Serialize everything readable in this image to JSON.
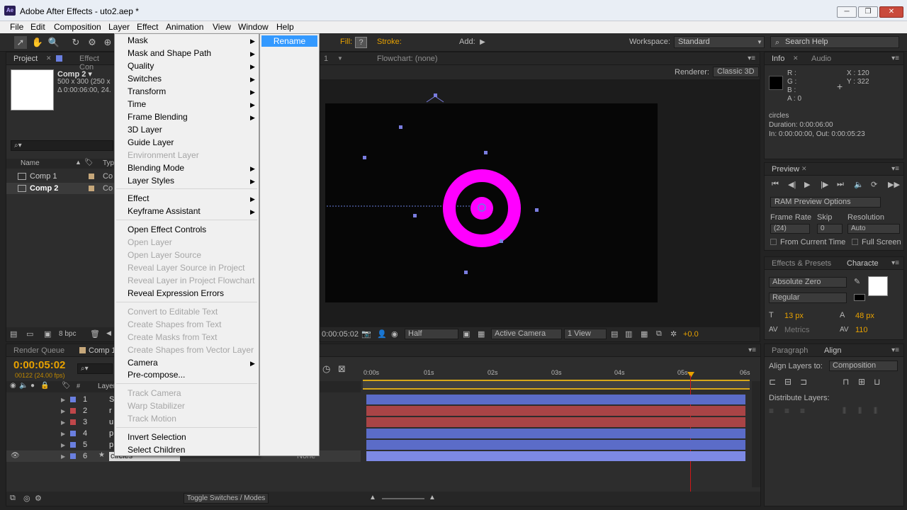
{
  "window": {
    "title": "Adobe After Effects - uto2.aep *",
    "app_icon": "Ae"
  },
  "menubar": {
    "items": [
      "File",
      "Edit",
      "Composition",
      "Layer",
      "Effect",
      "Animation",
      "View",
      "Window",
      "Help"
    ]
  },
  "toolbar": {
    "fill_label": "Fill:",
    "stroke_label": "Stroke:",
    "add_label": "Add:",
    "workspace_label": "Workspace:",
    "workspace_value": "Standard",
    "search_placeholder": "Search Help"
  },
  "project_panel": {
    "tabs": [
      "Project",
      "Effect Con"
    ],
    "comp_name": "Comp 2 ▾",
    "comp_size": "500 x 300  (250 x",
    "comp_duration": "Δ 0:00:06:00, 24.",
    "column_name": "Name",
    "column_type": "Typ",
    "items": [
      {
        "name": "Comp 1",
        "type": "Co"
      },
      {
        "name": "Comp 2",
        "type": "Co"
      }
    ],
    "bpc": "8 bpc"
  },
  "viewer": {
    "tab_flowchart": "Flowchart: (none)",
    "tab_comp_num": "1",
    "renderer_label": "Renderer:",
    "renderer_value": "Classic 3D",
    "timecode": "0:00:05:02",
    "resolution": "Half",
    "camera": "Active Camera",
    "views": "1 View",
    "exposure": "+0.0"
  },
  "info_panel": {
    "tabs": [
      "Info",
      "Audio"
    ],
    "r": "R :",
    "g": "G :",
    "b": "B :",
    "a": "A :  0",
    "x": "X : 120",
    "y": "Y : 322",
    "layer_name": "circles",
    "duration": "Duration: 0:00:06:00",
    "in_out": "In: 0:00:00:00, Out: 0:00:05:23"
  },
  "preview_panel": {
    "tab": "Preview",
    "ram_options": "RAM Preview Options",
    "frame_rate_label": "Frame Rate",
    "skip_label": "Skip",
    "resolution_label": "Resolution",
    "frame_rate_value": "(24)",
    "skip_value": "0",
    "resolution_value": "Auto",
    "from_current": "From Current Time",
    "full_screen": "Full Screen"
  },
  "character_panel": {
    "tabs": [
      "Effects & Presets",
      "Characte"
    ],
    "font": "Absolute Zero",
    "style": "Regular",
    "size": "13 px",
    "leading": "48 px",
    "kerning": "Metrics",
    "tracking": "110"
  },
  "align_panel": {
    "tabs": [
      "Paragraph",
      "Align"
    ],
    "align_to_label": "Align Layers to:",
    "align_to_value": "Composition",
    "distribute_label": "Distribute Layers:"
  },
  "timeline": {
    "tabs": [
      "Render Queue",
      "Comp 1"
    ],
    "timecode": "0:00:05:02",
    "frames": "00122 (24.00 fps)",
    "ruler": [
      "0:00s",
      "01s",
      "02s",
      "03s",
      "04s",
      "05s",
      "06s"
    ],
    "layer_col": "Layer",
    "layers": [
      {
        "num": "1",
        "letter": "S",
        "color": "#6a7fe0"
      },
      {
        "num": "2",
        "letter": "r",
        "color": "#c0474a"
      },
      {
        "num": "3",
        "letter": "u",
        "color": "#c0474a"
      },
      {
        "num": "4",
        "letter": "p",
        "color": "#6a7fe0"
      },
      {
        "num": "5",
        "letter": "p",
        "color": "#6a7fe0"
      },
      {
        "num": "6",
        "letter": "circles",
        "color": "#6a7fe0"
      }
    ],
    "parent_none": "None",
    "toggle_label": "Toggle Switches / Modes"
  },
  "layer_menu": {
    "items": [
      {
        "label": "Mask",
        "sub": true,
        "disabled": false
      },
      {
        "label": "Mask and Shape Path",
        "sub": true,
        "disabled": false
      },
      {
        "label": "Quality",
        "sub": true,
        "disabled": false
      },
      {
        "label": "Switches",
        "sub": true,
        "disabled": false
      },
      {
        "label": "Transform",
        "sub": true,
        "disabled": false
      },
      {
        "label": "Time",
        "sub": true,
        "disabled": false
      },
      {
        "label": "Frame Blending",
        "sub": true,
        "disabled": false
      },
      {
        "label": "3D Layer",
        "sub": false,
        "disabled": false
      },
      {
        "label": "Guide Layer",
        "sub": false,
        "disabled": false
      },
      {
        "label": "Environment Layer",
        "sub": false,
        "disabled": true
      },
      {
        "label": "Blending Mode",
        "sub": true,
        "disabled": false
      },
      {
        "label": "Layer Styles",
        "sub": true,
        "disabled": false
      },
      {
        "label": "Effect",
        "sub": true,
        "disabled": false
      },
      {
        "label": "Keyframe Assistant",
        "sub": true,
        "disabled": false
      },
      {
        "label": "Open Effect Controls",
        "sub": false,
        "disabled": false
      },
      {
        "label": "Open Layer",
        "sub": false,
        "disabled": true
      },
      {
        "label": "Open Layer Source",
        "sub": false,
        "disabled": true
      },
      {
        "label": "Reveal Layer Source in Project",
        "sub": false,
        "disabled": true
      },
      {
        "label": "Reveal Layer in Project Flowchart",
        "sub": false,
        "disabled": true
      },
      {
        "label": "Reveal Expression Errors",
        "sub": false,
        "disabled": false
      },
      {
        "label": "Convert to Editable Text",
        "sub": false,
        "disabled": true
      },
      {
        "label": "Create Shapes from Text",
        "sub": false,
        "disabled": true
      },
      {
        "label": "Create Masks from Text",
        "sub": false,
        "disabled": true
      },
      {
        "label": "Create Shapes from Vector Layer",
        "sub": false,
        "disabled": true
      },
      {
        "label": "Camera",
        "sub": true,
        "disabled": false
      },
      {
        "label": "Pre-compose...",
        "sub": false,
        "disabled": false
      },
      {
        "label": "Track Camera",
        "sub": false,
        "disabled": true
      },
      {
        "label": "Warp Stabilizer",
        "sub": false,
        "disabled": true
      },
      {
        "label": "Track Motion",
        "sub": false,
        "disabled": true
      },
      {
        "label": "Invert Selection",
        "sub": false,
        "disabled": false
      },
      {
        "label": "Select Children",
        "sub": false,
        "disabled": false
      }
    ],
    "submenu_selected": "Rename"
  },
  "colors": {
    "accent": "#e7a100",
    "ring": "#ff00ff",
    "selection": "#3399ff",
    "bar_blue": "#6a7fe0",
    "bar_red": "#c0474a"
  }
}
